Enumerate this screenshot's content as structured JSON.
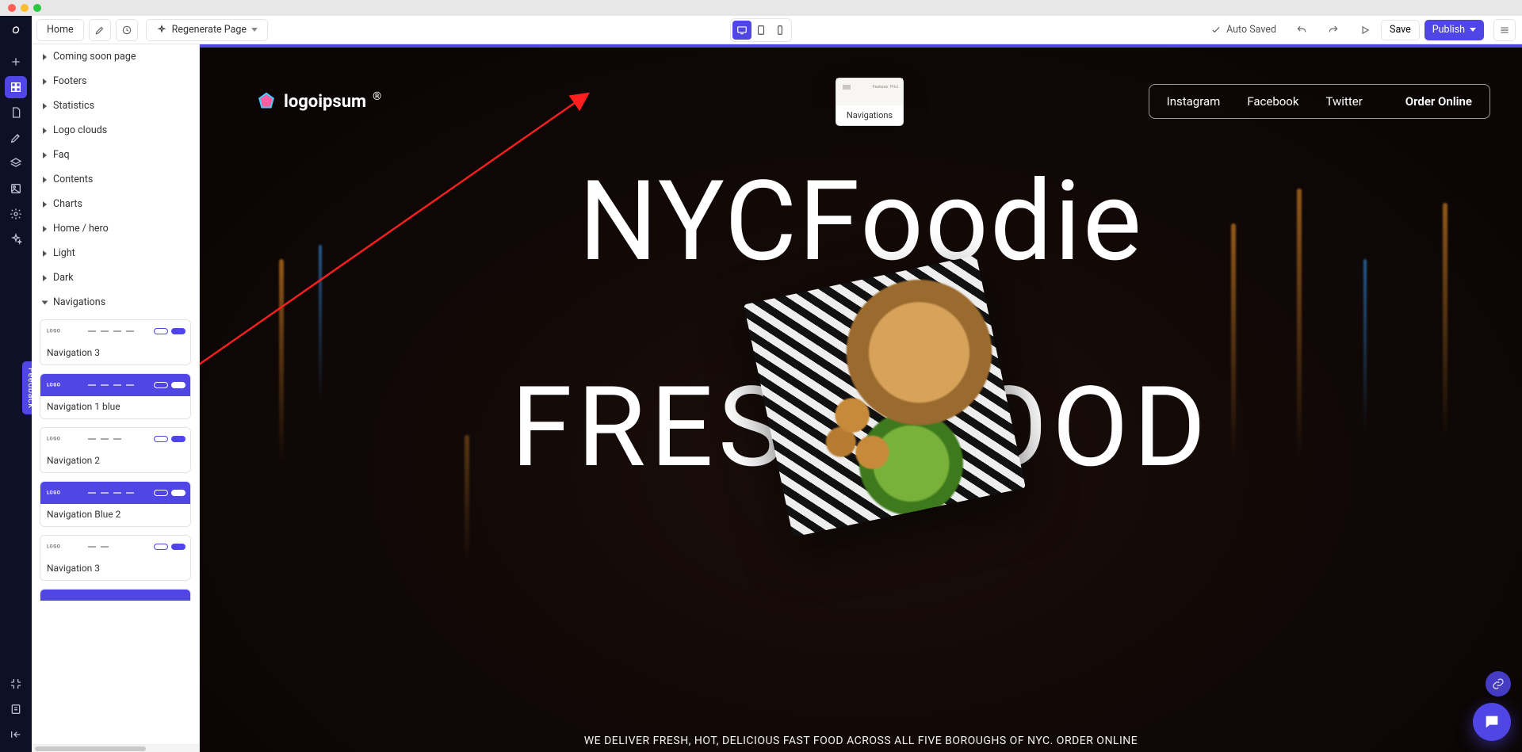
{
  "toolbar": {
    "page_name": "Home",
    "regenerate_label": "Regenerate Page",
    "auto_saved_label": "Auto Saved",
    "save_label": "Save",
    "publish_label": "Publish"
  },
  "panel": {
    "categories": [
      "Coming soon page",
      "Footers",
      "Statistics",
      "Logo clouds",
      "Faq",
      "Contents",
      "Charts",
      "Home / hero",
      "Light",
      "Dark",
      "Navigations"
    ],
    "nav_thumbs": [
      {
        "label": "Navigation 3",
        "variant": "light"
      },
      {
        "label": "Navigation 1 blue",
        "variant": "blue"
      },
      {
        "label": "Navigation 2",
        "variant": "light"
      },
      {
        "label": "Navigation Blue 2",
        "variant": "blue"
      },
      {
        "label": "Navigation 3",
        "variant": "light"
      }
    ]
  },
  "drag_ghost": {
    "label": "Navigations",
    "mini_links": [
      "Features",
      "Prici"
    ]
  },
  "feedback": {
    "label": "Feedback"
  },
  "site": {
    "brand": "logoipsum",
    "nav": [
      "Instagram",
      "Facebook",
      "Twitter"
    ],
    "cta": "Order Online",
    "hero_line1": "NYCFoodie",
    "hero_line2": "FRESH FOOD",
    "hero_sub": "WE DELIVER FRESH, HOT, DELICIOUS FAST FOOD ACROSS ALL FIVE BOROUGHS OF NYC. ORDER ONLINE"
  }
}
